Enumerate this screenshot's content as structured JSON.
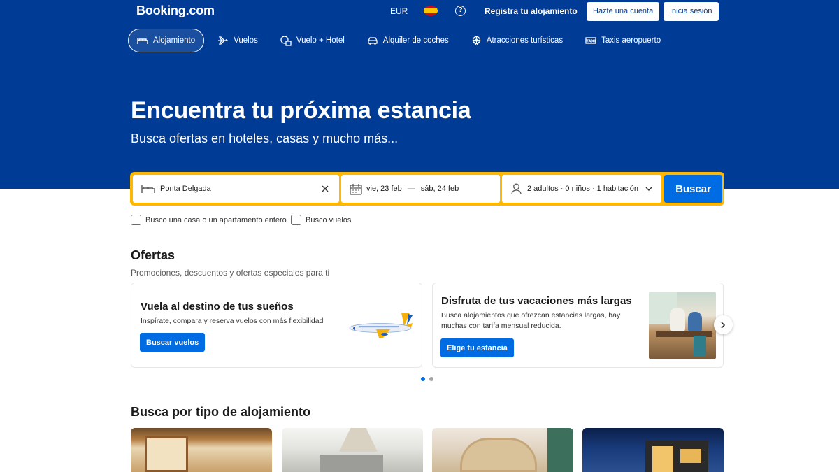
{
  "brand": {
    "logo_text": "Booking.com"
  },
  "header": {
    "currency": "EUR",
    "language_flag": "spain-flag",
    "help_icon": "?",
    "register_property": "Registra tu alojamiento",
    "sign_up": "Hazte una cuenta",
    "sign_in": "Inicia sesión"
  },
  "nav": {
    "items": [
      {
        "label": "Alojamiento",
        "icon": "bed-icon",
        "active": true
      },
      {
        "label": "Vuelos",
        "icon": "plane-icon"
      },
      {
        "label": "Vuelo + Hotel",
        "icon": "plane-hotel-icon"
      },
      {
        "label": "Alquiler de coches",
        "icon": "car-icon"
      },
      {
        "label": "Atracciones turísticas",
        "icon": "ferris-wheel-icon"
      },
      {
        "label": "Taxis aeropuerto",
        "icon": "taxi-icon"
      }
    ]
  },
  "hero": {
    "title": "Encuentra tu próxima estancia",
    "subtitle": "Busca ofertas en hoteles, casas y mucho más..."
  },
  "search": {
    "destination_value": "Ponta Delgada",
    "checkin": "vie, 23 feb",
    "dash": "—",
    "checkout": "sáb, 24 feb",
    "occupancy": "2 adultos · 0 niños · 1 habitación",
    "button": "Buscar"
  },
  "filters": {
    "whole_home": "Busco una casa o un apartamento entero",
    "flights": "Busco vuelos"
  },
  "offers": {
    "title": "Ofertas",
    "subtitle": "Promociones, descuentos y ofertas especiales para ti",
    "cards": [
      {
        "title": "Vuela al destino de tus sueños",
        "text": "Inspírate, compara y reserva vuelos con más flexibilidad",
        "button": "Buscar vuelos",
        "image": "airplane-illustration"
      },
      {
        "title": "Disfruta de tus vacaciones más largas",
        "text_line1": "Busca alojamientos que ofrezcan estancias largas, hay",
        "text_line2": "muchas con tarifa mensual reducida.",
        "button": "Elige tu estancia",
        "image": "family-photo"
      }
    ],
    "carousel_page": 1,
    "carousel_pages": 2
  },
  "property_types": {
    "title": "Busca por tipo de alojamiento"
  },
  "colors": {
    "brand_blue": "#003b95",
    "accent_yellow": "#ffb700",
    "button_blue": "#006ce4"
  }
}
